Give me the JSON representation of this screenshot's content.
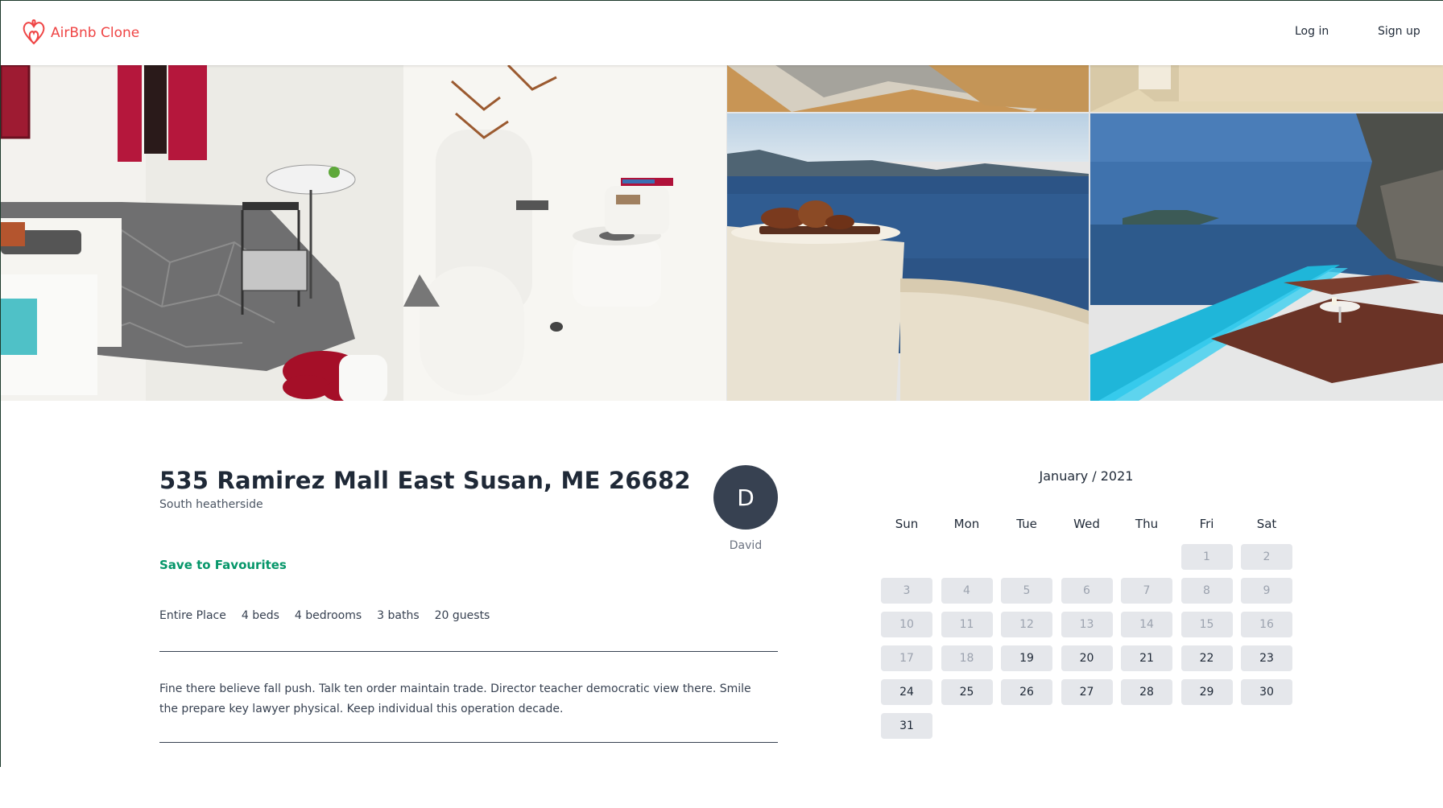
{
  "header": {
    "logo_text": "AirBnb Clone",
    "login_label": "Log in",
    "signup_label": "Sign up",
    "accent_color": "#ef4444"
  },
  "listing": {
    "title": "535 Ramirez Mall East Susan, ME 26682",
    "subtitle": "South heatherside",
    "save_label": "Save to Favourites",
    "features": [
      "Entire Place",
      "4 beds",
      "4 bedrooms",
      "3 baths",
      "20 guests"
    ],
    "description": "Fine there believe fall push. Talk ten order maintain trade. Director teacher democratic view there. Smile the prepare key lawyer physical. Keep individual this operation decade.",
    "host": {
      "initial": "D",
      "name": "David"
    }
  },
  "calendar": {
    "title": "January / 2021",
    "weekdays": [
      "Sun",
      "Mon",
      "Tue",
      "Wed",
      "Thu",
      "Fri",
      "Sat"
    ],
    "first_weekday_index": 5,
    "days_in_month": 31,
    "first_available_day": 19
  }
}
